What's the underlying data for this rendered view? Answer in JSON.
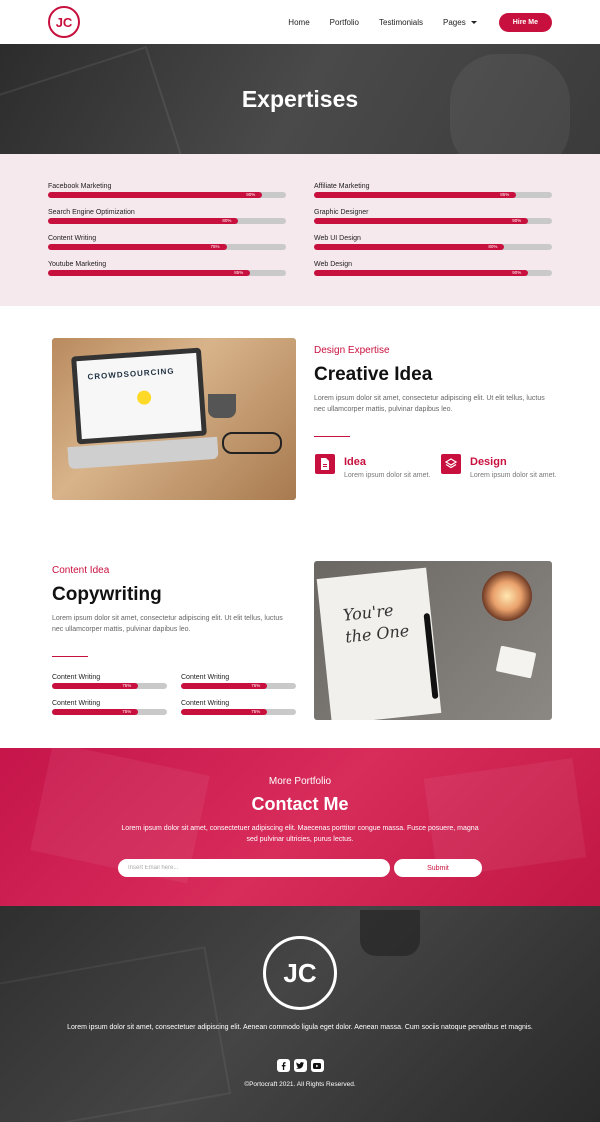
{
  "nav": {
    "logo": "JC",
    "links": [
      "Home",
      "Portfolio",
      "Testimonials",
      "Pages"
    ],
    "hire_label": "Hire Me"
  },
  "hero": {
    "title": "Expertises"
  },
  "skills": {
    "left": [
      {
        "label": "Facebook Marketing",
        "pct": "90%",
        "value": 90
      },
      {
        "label": "Search Engine Optimization",
        "pct": "80%",
        "value": 80
      },
      {
        "label": "Content Writing",
        "pct": "75%",
        "value": 75
      },
      {
        "label": "Youtube Marketing",
        "pct": "85%",
        "value": 85
      }
    ],
    "right": [
      {
        "label": "Affiliate Marketing",
        "pct": "85%",
        "value": 85
      },
      {
        "label": "Graphic Designer",
        "pct": "90%",
        "value": 90
      },
      {
        "label": "Web UI Design",
        "pct": "80%",
        "value": 80
      },
      {
        "label": "Web Design",
        "pct": "90%",
        "value": 90
      }
    ]
  },
  "creative": {
    "kicker": "Design Expertise",
    "title": "Creative Idea",
    "desc": "Lorem ipsum dolor sit amet, consectetur adipiscing elit. Ut elit tellus, luctus nec ullamcorper mattis, pulvinar dapibus leo.",
    "image_text": "CROWDSOURCING",
    "features": [
      {
        "title": "Idea",
        "desc": "Lorem ipsum dolor sit amet."
      },
      {
        "title": "Design",
        "desc": "Lorem ipsum dolor sit amet."
      }
    ]
  },
  "copywriting": {
    "kicker": "Content Idea",
    "title": "Copywriting",
    "desc": "Lorem ipsum dolor sit amet, consectetur adipiscing elit. Ut elit tellus, luctus nec ullamcorper mattis, pulvinar dapibus leo.",
    "image_text": "You're the One",
    "bars": [
      {
        "label": "Content Writing",
        "pct": "75%",
        "value": 75
      },
      {
        "label": "Content Writing",
        "pct": "75%",
        "value": 75
      },
      {
        "label": "Content Writing",
        "pct": "75%",
        "value": 75
      },
      {
        "label": "Content Writing",
        "pct": "75%",
        "value": 75
      }
    ]
  },
  "contact": {
    "kicker": "More Portfolio",
    "title": "Contact Me",
    "desc": "Lorem ipsum dolor sit amet, consectetuer adipiscing elit. Maecenas porttitor congue massa. Fusce posuere, magna sed pulvinar ultricies, purus lectus.",
    "placeholder": "Insert Email here...",
    "submit_label": "Submit"
  },
  "footer": {
    "logo": "JC",
    "desc": "Lorem ipsum dolor sit amet, consectetuer adipiscing elit. Aenean commodo ligula eget dolor. Aenean massa. Cum sociis natoque penatibus et magnis.",
    "socials": [
      "facebook-icon",
      "twitter-icon",
      "youtube-icon"
    ],
    "copyright": "©Portocraft 2021. All Rights Reserved."
  },
  "colors": {
    "accent": "#c8103e",
    "skills_bg": "#f6e9ed",
    "bar_track": "#c9c9c9"
  }
}
